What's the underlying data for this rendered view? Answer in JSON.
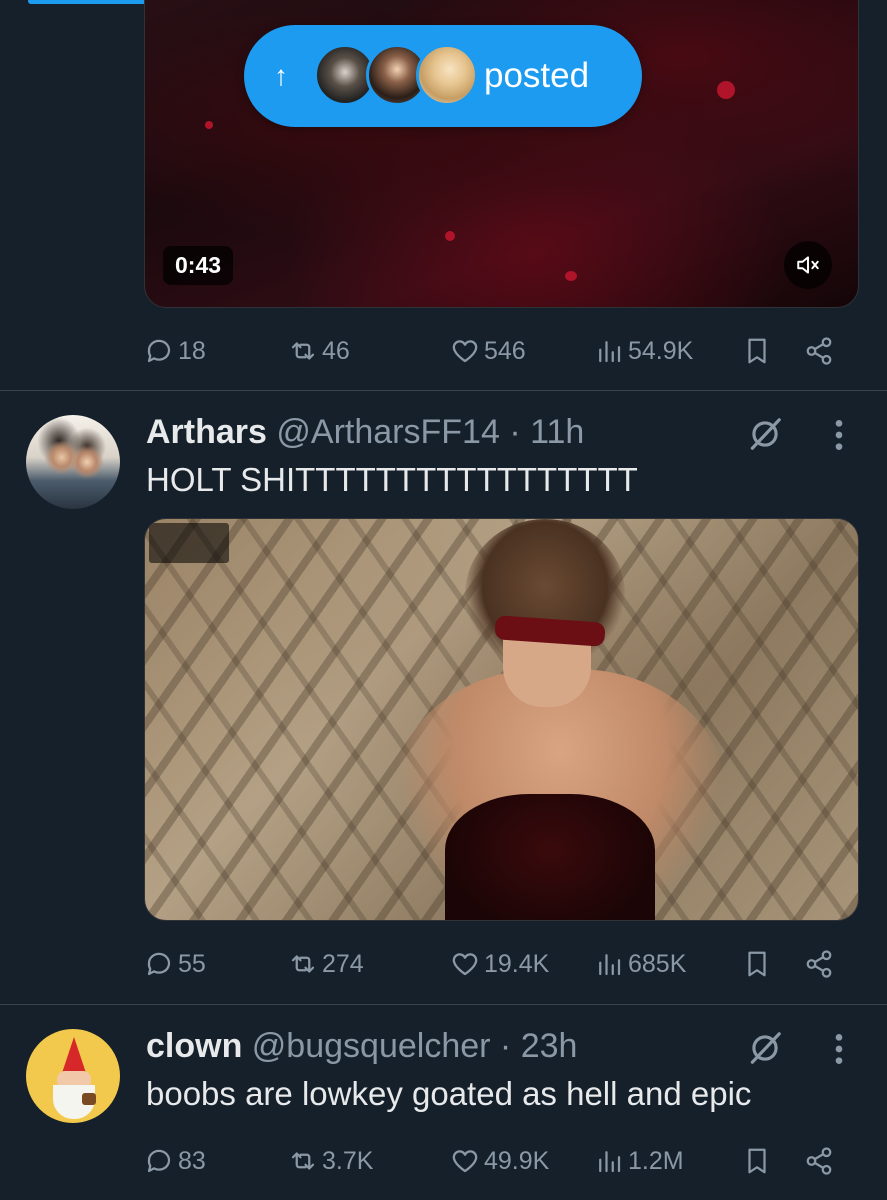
{
  "posted_pill": {
    "label": "posted",
    "arrow": "↑"
  },
  "tweets": [
    {
      "media": {
        "type": "video",
        "duration": "0:43",
        "mute_icon": "mute-icon"
      },
      "actions": {
        "replies": "18",
        "reposts": "46",
        "likes": "546",
        "views": "54.9K"
      }
    },
    {
      "display_name": "Arthars",
      "handle": "@ArtharsFF14",
      "separator": "·",
      "time": "11h",
      "text": "HOLT SHITTTTTTTTTTTTTTTTT",
      "media": {
        "type": "image"
      },
      "actions": {
        "replies": "55",
        "reposts": "274",
        "likes": "19.4K",
        "views": "685K"
      }
    },
    {
      "display_name": "clown",
      "handle": "@bugsquelcher",
      "separator": "·",
      "time": "23h",
      "text": "boobs are lowkey goated as hell and epic",
      "actions": {
        "replies": "83",
        "reposts": "3.7K",
        "likes": "49.9K",
        "views": "1.2M"
      }
    }
  ],
  "colors": {
    "background": "#15202b",
    "accent": "#1d9bf0",
    "secondary_text": "#8b98a5",
    "primary_text": "#e7e9ea",
    "divider": "#38444d"
  }
}
